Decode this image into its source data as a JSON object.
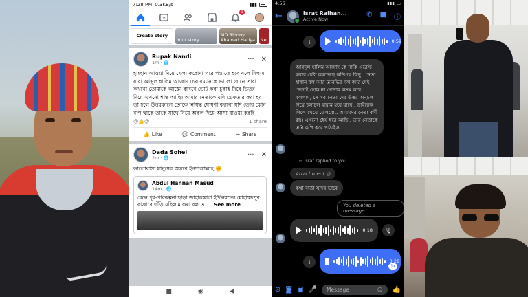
{
  "facebook": {
    "status": {
      "time": "7:28 PM",
      "speed": "0.3KB/s"
    },
    "nav": {
      "notif_count": "1"
    },
    "stories": [
      {
        "label": "Create story"
      },
      {
        "label": "Your story"
      },
      {
        "label": "MD Riddoy Ahamed Hatiya"
      },
      {
        "label": "Ne"
      }
    ],
    "post1": {
      "author": "Rupak Nandi",
      "time": "1m · ",
      "text": "হাচ্ছান আওয়া দিয়ে খেলা করোনা পরে পস্তাতে হবে বলে দিলাম যারা আব্দুল হালিম আজাদ চেয়ারম্যানকে ভালো জানে তারা কখনো তোমাকে আস্তো রাখবে ভোট করা চুকাই দিবে ভিতর দিয়ে।এখনো শান্ত আছি। আমার নেতাকে যদি গ্রেফতার করা হয় তা হলে উত্তরকালে তোকে নিষিদ্ধ ঘোষণা করবো যদি তোর কোন বাপ থাকে তাকে সাথে নিয়ে অকল দিয়ে আসা যাওয়া করবি",
      "reactions": "😢👍😡",
      "shares": "1 share",
      "like": "Like",
      "comment": "Comment",
      "share": "Share"
    },
    "post2": {
      "author": "Dada Sohel",
      "time": "2m · ",
      "text": "ভালোবাসা মানুষের অন্তরে ইনশাআল্লাহ ✊",
      "shared_author": "Abdul Hannan Masud",
      "shared_time": "14m · ",
      "shared_text": "কোন পূর্ব-পরিকল্পনা ছাড়া জাহাজমারা ইউনিয়নের মোহাম্মদপুর বাজারে দাঁড়িয়েছিলাম কথা বলতে..... ",
      "see_more": "See more"
    }
  },
  "messenger": {
    "status": {
      "time": "4:56"
    },
    "contact": "Israt Raihan...",
    "status_text": "Active Now",
    "voice1": "0:59",
    "text_msg": "আবদুল হালিম আজাদ কে নাকি এরেস্ট করার চেষ্টা করতেছে কতিপয় কিছু.. নেতা. হান্নান বল আর তানভির বল আর যেই নেতাই হোক না খোদার কসম করে বললাম, সে সব নেতা দের উত্তর অন্চল দিয়ে চলাচল হারাম হয়ে যাবে,, ডাইরেক গিলে খেয়ে ফেলবো.. আমাদের নেতা কর্মী রা।। এখনো ধৈর্য ধরে আছি,, তার নেতাকে এটা কপি করে পাঠাইস",
    "reply_hint": "Israt replied to you",
    "attachment": "Attachment",
    "short_msg": "কথা বার্তা সুন্দর ভাবে",
    "deleted": "You deleted a message",
    "voice2": "0:18",
    "voice3": "0:28",
    "speed": "1x",
    "input_placeholder": "Message"
  }
}
